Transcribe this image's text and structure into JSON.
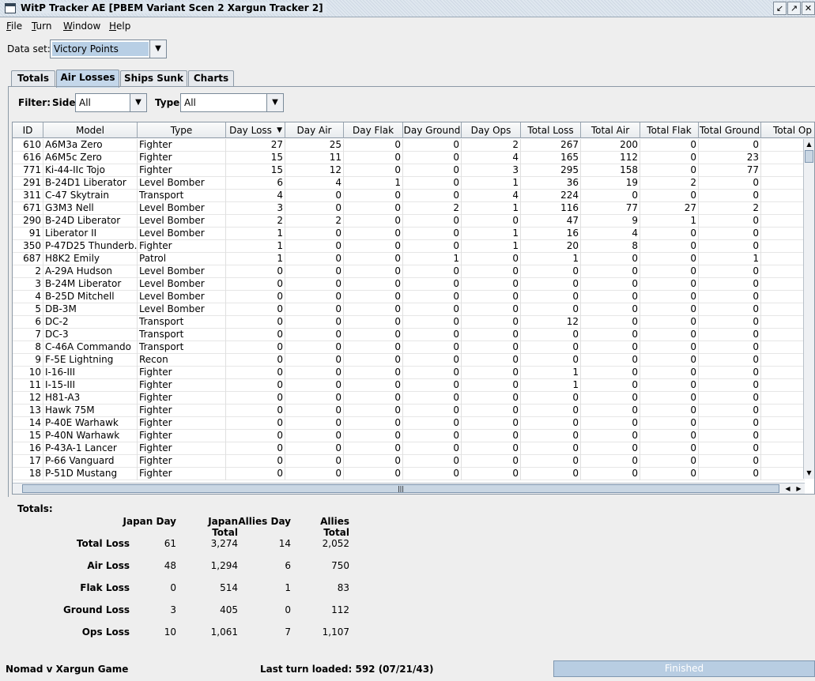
{
  "window": {
    "title": "WitP Tracker AE [PBEM Variant Scen 2 Xargun Tracker 2]"
  },
  "menu": [
    "File",
    "Turn",
    "Window",
    "Help"
  ],
  "dataset": {
    "label": "Data set:",
    "value": "Victory Points"
  },
  "tabs": [
    "Totals",
    "Air Losses",
    "Ships Sunk",
    "Charts"
  ],
  "active_tab": "Air Losses",
  "filter": {
    "label": "Filter:",
    "side_label": "Side:",
    "side_value": "All",
    "type_label": "Type:",
    "type_value": "All"
  },
  "table": {
    "columns": [
      "ID",
      "Model",
      "Type",
      "Day Loss",
      "Day Air",
      "Day Flak",
      "Day Ground",
      "Day Ops",
      "Total Loss",
      "Total Air",
      "Total Flak",
      "Total Ground",
      "Total Op"
    ],
    "rows": [
      [
        "610",
        "A6M3a Zero",
        "Fighter",
        "27",
        "25",
        "0",
        "0",
        "2",
        "267",
        "200",
        "0",
        "0"
      ],
      [
        "616",
        "A6M5c Zero",
        "Fighter",
        "15",
        "11",
        "0",
        "0",
        "4",
        "165",
        "112",
        "0",
        "23"
      ],
      [
        "771",
        "Ki-44-IIc Tojo",
        "Fighter",
        "15",
        "12",
        "0",
        "0",
        "3",
        "295",
        "158",
        "0",
        "77"
      ],
      [
        "291",
        "B-24D1 Liberator",
        "Level Bomber",
        "6",
        "4",
        "1",
        "0",
        "1",
        "36",
        "19",
        "2",
        "0"
      ],
      [
        "311",
        "C-47 Skytrain",
        "Transport",
        "4",
        "0",
        "0",
        "0",
        "4",
        "224",
        "0",
        "0",
        "0"
      ],
      [
        "671",
        "G3M3 Nell",
        "Level Bomber",
        "3",
        "0",
        "0",
        "2",
        "1",
        "116",
        "77",
        "27",
        "2"
      ],
      [
        "290",
        "B-24D Liberator",
        "Level Bomber",
        "2",
        "2",
        "0",
        "0",
        "0",
        "47",
        "9",
        "1",
        "0"
      ],
      [
        "91",
        "Liberator II",
        "Level Bomber",
        "1",
        "0",
        "0",
        "0",
        "1",
        "16",
        "4",
        "0",
        "0"
      ],
      [
        "350",
        "P-47D25 Thunderb...",
        "Fighter",
        "1",
        "0",
        "0",
        "0",
        "1",
        "20",
        "8",
        "0",
        "0"
      ],
      [
        "687",
        "H8K2 Emily",
        "Patrol",
        "1",
        "0",
        "0",
        "1",
        "0",
        "1",
        "0",
        "0",
        "1"
      ],
      [
        "2",
        "A-29A Hudson",
        "Level Bomber",
        "0",
        "0",
        "0",
        "0",
        "0",
        "0",
        "0",
        "0",
        "0"
      ],
      [
        "3",
        "B-24M Liberator",
        "Level Bomber",
        "0",
        "0",
        "0",
        "0",
        "0",
        "0",
        "0",
        "0",
        "0"
      ],
      [
        "4",
        "B-25D Mitchell",
        "Level Bomber",
        "0",
        "0",
        "0",
        "0",
        "0",
        "0",
        "0",
        "0",
        "0"
      ],
      [
        "5",
        "DB-3M",
        "Level Bomber",
        "0",
        "0",
        "0",
        "0",
        "0",
        "0",
        "0",
        "0",
        "0"
      ],
      [
        "6",
        "DC-2",
        "Transport",
        "0",
        "0",
        "0",
        "0",
        "0",
        "12",
        "0",
        "0",
        "0"
      ],
      [
        "7",
        "DC-3",
        "Transport",
        "0",
        "0",
        "0",
        "0",
        "0",
        "0",
        "0",
        "0",
        "0"
      ],
      [
        "8",
        "C-46A Commando",
        "Transport",
        "0",
        "0",
        "0",
        "0",
        "0",
        "0",
        "0",
        "0",
        "0"
      ],
      [
        "9",
        "F-5E Lightning",
        "Recon",
        "0",
        "0",
        "0",
        "0",
        "0",
        "0",
        "0",
        "0",
        "0"
      ],
      [
        "10",
        "I-16-III",
        "Fighter",
        "0",
        "0",
        "0",
        "0",
        "0",
        "1",
        "0",
        "0",
        "0"
      ],
      [
        "11",
        "I-15-III",
        "Fighter",
        "0",
        "0",
        "0",
        "0",
        "0",
        "1",
        "0",
        "0",
        "0"
      ],
      [
        "12",
        "H81-A3",
        "Fighter",
        "0",
        "0",
        "0",
        "0",
        "0",
        "0",
        "0",
        "0",
        "0"
      ],
      [
        "13",
        "Hawk 75M",
        "Fighter",
        "0",
        "0",
        "0",
        "0",
        "0",
        "0",
        "0",
        "0",
        "0"
      ],
      [
        "14",
        "P-40E Warhawk",
        "Fighter",
        "0",
        "0",
        "0",
        "0",
        "0",
        "0",
        "0",
        "0",
        "0"
      ],
      [
        "15",
        "P-40N Warhawk",
        "Fighter",
        "0",
        "0",
        "0",
        "0",
        "0",
        "0",
        "0",
        "0",
        "0"
      ],
      [
        "16",
        "P-43A-1 Lancer",
        "Fighter",
        "0",
        "0",
        "0",
        "0",
        "0",
        "0",
        "0",
        "0",
        "0"
      ],
      [
        "17",
        "P-66 Vanguard",
        "Fighter",
        "0",
        "0",
        "0",
        "0",
        "0",
        "0",
        "0",
        "0",
        "0"
      ],
      [
        "18",
        "P-51D Mustang",
        "Fighter",
        "0",
        "0",
        "0",
        "0",
        "0",
        "0",
        "0",
        "0",
        "0"
      ]
    ]
  },
  "totals": {
    "title": "Totals:",
    "headers": [
      "Japan Day",
      "Japan Total",
      "Allies Day",
      "Allies Total"
    ],
    "rows": [
      {
        "label": "Total Loss",
        "values": [
          "61",
          "3,274",
          "14",
          "2,052"
        ]
      },
      {
        "label": "Air Loss",
        "values": [
          "48",
          "1,294",
          "6",
          "750"
        ]
      },
      {
        "label": "Flak Loss",
        "values": [
          "0",
          "514",
          "1",
          "83"
        ]
      },
      {
        "label": "Ground Loss",
        "values": [
          "3",
          "405",
          "0",
          "112"
        ]
      },
      {
        "label": "Ops Loss",
        "values": [
          "10",
          "1,061",
          "7",
          "1,107"
        ]
      }
    ]
  },
  "status": {
    "game": "Nomad v Xargun Game",
    "last_turn": "Last turn loaded: 592 (07/21/43)",
    "progress_text": "Finished"
  }
}
